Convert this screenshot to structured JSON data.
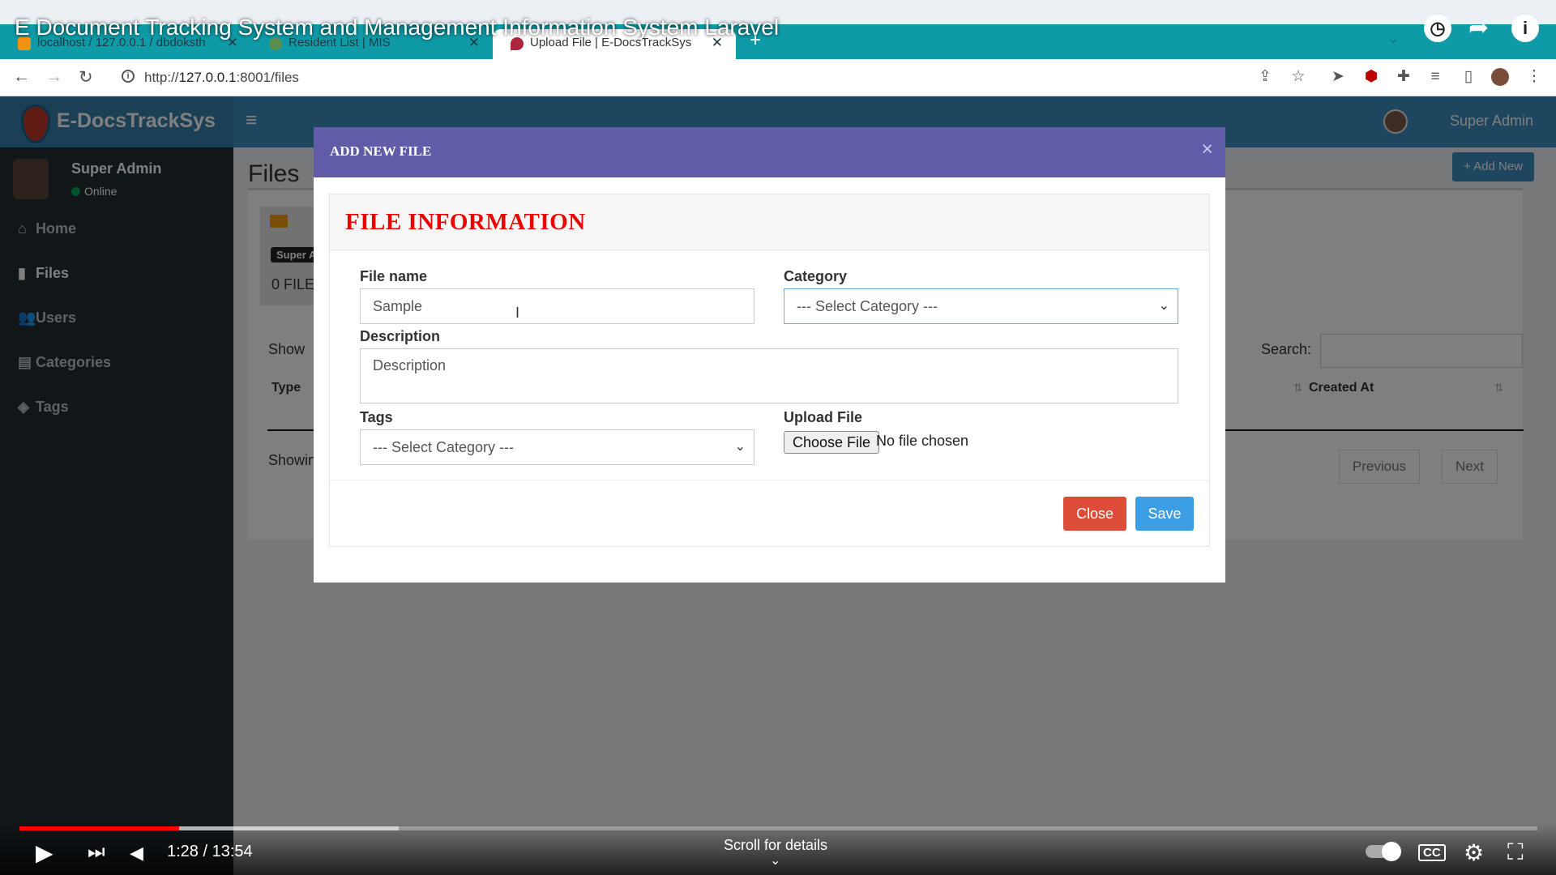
{
  "video": {
    "title": "E Document Tracking System and Management Information System Laravel",
    "time": "1:28 / 13:54",
    "scroll_hint": "Scroll for details",
    "progress_played": 0.105,
    "progress_buffered": 0.25
  },
  "browser": {
    "tabs": [
      {
        "label": "localhost / 127.0.0.1 / dbdoksth",
        "active": false
      },
      {
        "label": "Resident List | MIS",
        "active": false
      },
      {
        "label": "Upload File | E-DocsTrackSys",
        "active": true
      }
    ],
    "new_tab": "+",
    "url_host": "127.0.0.1",
    "url_prefix": "http://",
    "url_rest": ":8001/files"
  },
  "app": {
    "brand": "E-DocsTrackSys",
    "header_user": "Super Admin",
    "sidebar": {
      "user_name": "Super Admin",
      "status": "Online",
      "items": [
        {
          "label": "Home",
          "icon": "home-icon"
        },
        {
          "label": "Files",
          "icon": "file-icon"
        },
        {
          "label": "Users",
          "icon": "users-icon"
        },
        {
          "label": "Categories",
          "icon": "book-icon"
        },
        {
          "label": "Tags",
          "icon": "tags-icon"
        }
      ]
    },
    "page_title": "Files",
    "add_new": "+ Add New",
    "info_badge": "Super A",
    "files_count": "0 FILE",
    "show_label": "Show",
    "search_label": "Search:",
    "col_type": "Type",
    "col_created": "Created At",
    "showing": "Showin",
    "prev": "Previous",
    "next": "Next"
  },
  "modal": {
    "title": "ADD NEW FILE",
    "close_glyph": "×",
    "panel_title": "FILE INFORMATION",
    "file_name_label": "File name",
    "file_name_value": "Sample",
    "category_label": "Category",
    "category_value": "--- Select Category ---",
    "description_label": "Description",
    "description_placeholder": "Description",
    "tags_label": "Tags",
    "tags_value": "--- Select Category ---",
    "upload_label": "Upload File",
    "choose_file": "Choose File",
    "no_file": "No file chosen",
    "close_btn": "Close",
    "save_btn": "Save"
  },
  "colors": {
    "tab_bar": "#0e9aa6",
    "header": "#3c8dbc",
    "modal_header": "#605ca8",
    "panel_title": "#ee0000",
    "close_btn": "#dd4b39",
    "save_btn": "#3c9ee5"
  }
}
